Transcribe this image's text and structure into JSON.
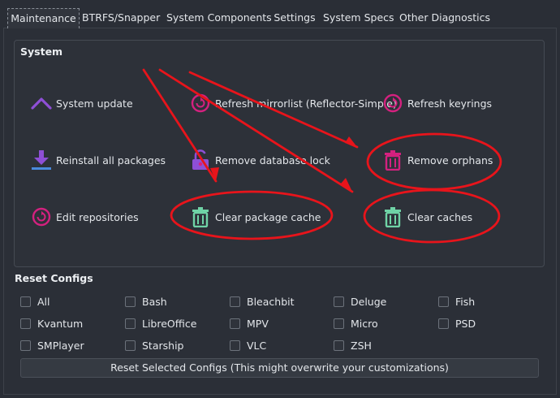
{
  "tabs": [
    {
      "label": "Maintenance"
    },
    {
      "label": "BTRFS/Snapper"
    },
    {
      "label": "System Components"
    },
    {
      "label": "Settings"
    },
    {
      "label": "System Specs"
    },
    {
      "label": "Other Diagnostics"
    }
  ],
  "system": {
    "title": "System",
    "actions": [
      {
        "label": "System update",
        "icon": "chevron-up-icon"
      },
      {
        "label": "Refresh mirrorlist (Reflector-Simple)",
        "icon": "refresh-icon"
      },
      {
        "label": "Refresh keyrings",
        "icon": "refresh-icon"
      },
      {
        "label": "Reinstall all packages",
        "icon": "download-icon"
      },
      {
        "label": "Remove database lock",
        "icon": "unlock-icon"
      },
      {
        "label": "Remove orphans",
        "icon": "trash-icon"
      },
      {
        "label": "Edit repositories",
        "icon": "refresh-icon"
      },
      {
        "label": "Clear package cache",
        "icon": "trash-icon"
      },
      {
        "label": "Clear caches",
        "icon": "trash-icon"
      }
    ]
  },
  "reset": {
    "title": "Reset Configs",
    "options": [
      "All",
      "Bash",
      "Bleachbit",
      "Deluge",
      "Fish",
      "Kvantum",
      "LibreOffice",
      "MPV",
      "Micro",
      "PSD",
      "SMPlayer",
      "Starship",
      "VLC",
      "ZSH"
    ],
    "button_label": "Reset Selected Configs (This might overwrite your customizations)"
  },
  "colors": {
    "background": "#2a2e36",
    "annotation": "#e8141b",
    "icon_magenta": "#d4217f",
    "icon_purple": "#8e4fd6",
    "icon_green": "#6fd3a6"
  }
}
